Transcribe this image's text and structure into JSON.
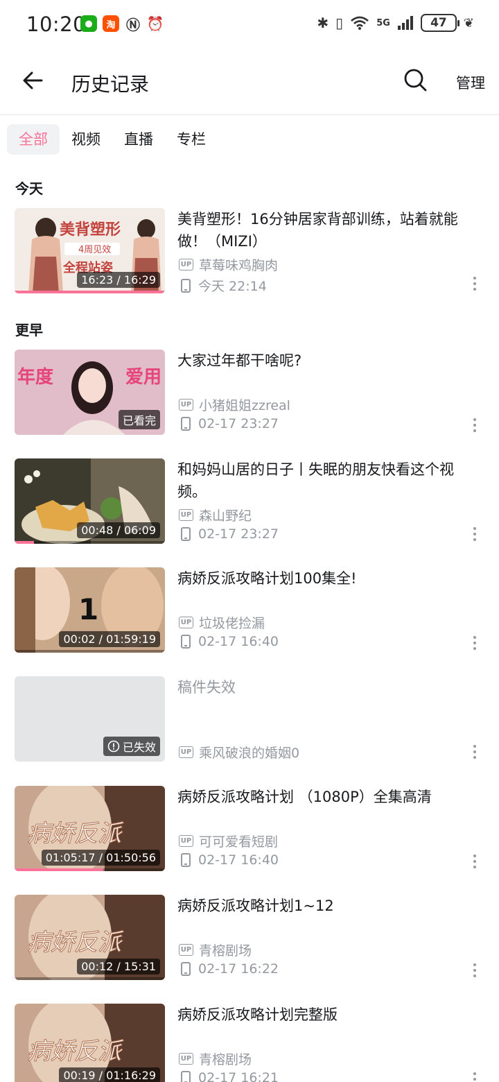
{
  "status_bar": {
    "time": "10:20",
    "battery": "47",
    "network": "5G"
  },
  "header": {
    "title": "历史记录",
    "manage_label": "管理"
  },
  "tabs": [
    {
      "label": "全部",
      "active": true
    },
    {
      "label": "视频",
      "active": false
    },
    {
      "label": "直播",
      "active": false
    },
    {
      "label": "专栏",
      "active": false
    }
  ],
  "sections": {
    "today_label": "今天",
    "earlier_label": "更早"
  },
  "items": [
    {
      "title": "美背塑形！16分钟居家背部训练，站着就能做！（MIZI）",
      "up": "草莓味鸡胸肉",
      "time": "今天 22:14",
      "badge": "16:23 / 16:29",
      "progress": 0.99
    },
    {
      "title": "大家过年都干啥呢?",
      "up": "小猪姐姐zzreal",
      "time": "02-17 23:27",
      "badge": "已看完",
      "progress": null
    },
    {
      "title": "和妈妈山居的日子丨失眠的朋友快看这个视频。",
      "up": "森山野纪",
      "time": "02-17 23:27",
      "badge": "00:48 / 06:09",
      "progress": 0.13
    },
    {
      "title": "病娇反派攻略计划100集全!",
      "up": "垃圾佬捡漏",
      "time": "02-17 16:40",
      "badge": "00:02 / 01:59:19",
      "progress": 0.0
    },
    {
      "title": "稿件失效",
      "up": "乘风破浪的婚姻0",
      "time": "",
      "badge": "已失效",
      "progress": null,
      "invalid": true
    },
    {
      "title": "病娇反派攻略计划 （1080P）全集高清",
      "up": "可可爱看短剧",
      "time": "02-17 16:40",
      "badge": "01:05:17 / 01:50:56",
      "progress": 0.59
    },
    {
      "title": "病娇反派攻略计划1~12",
      "up": "青榕剧场",
      "time": "02-17 16:22",
      "badge": "00:12 / 15:31",
      "progress": 0.01
    },
    {
      "title": "病娇反派攻略计划完整版",
      "up": "青榕剧场",
      "time": "02-17 16:21",
      "badge": "00:19 / 01:16:29",
      "progress": 0.004
    }
  ],
  "thumb_text": {
    "item0_overlay": "美背塑形",
    "item0_sub1": "4周见效",
    "item0_sub2": "全程站姿",
    "item1_overlay_left": "年度",
    "item1_overlay_right": "爱用",
    "item3_overlay": "1",
    "item5_overlay": "病娇反派",
    "item6_overlay": "病娇反派",
    "item7_overlay": "病娇反派"
  },
  "colors": {
    "accent": "#fb7299",
    "text": "#18191c",
    "muted": "#9499a0"
  }
}
